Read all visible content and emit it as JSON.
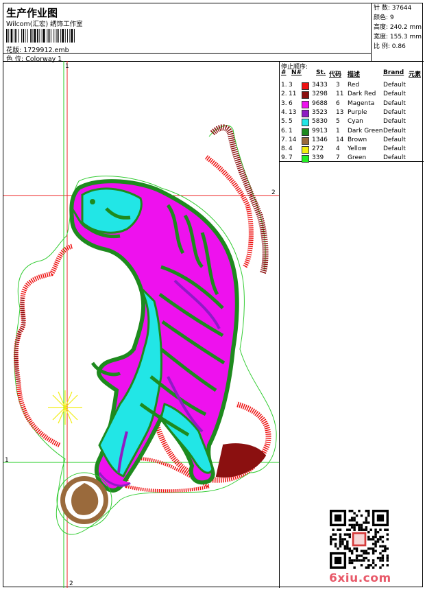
{
  "header": {
    "title": "生产作业图",
    "subtitle": "Wilcom(汇宏) 绣饰工作室"
  },
  "design": {
    "file_label": "花版: 1729912.emb",
    "colorway_label": "色 位:  Colorway 1"
  },
  "stats": [
    "针 数: 37644",
    "颜色: 9",
    "高度: 240.2 mm",
    "宽度: 155.3 mm",
    "比 例: 0.86"
  ],
  "sequence": {
    "title": "停止顺序:",
    "headers": {
      "num": "#",
      "n": "N#",
      "st": "St.",
      "code": "代码",
      "desc": "描述",
      "brand": "Brand",
      "element": "元素"
    },
    "rows": [
      {
        "idx": "1.",
        "n": "3",
        "color": "#ee1111",
        "st": "3433",
        "code": "3",
        "desc": "Red",
        "brand": "Default"
      },
      {
        "idx": "2.",
        "n": "11",
        "color": "#8b1010",
        "st": "3298",
        "code": "11",
        "desc": "Dark Red",
        "brand": "Default"
      },
      {
        "idx": "3.",
        "n": "6",
        "color": "#ee11ee",
        "st": "9688",
        "code": "6",
        "desc": "Magenta",
        "brand": "Default"
      },
      {
        "idx": "4.",
        "n": "13",
        "color": "#8e1cc4",
        "st": "3523",
        "code": "13",
        "desc": "Purple",
        "brand": "Default"
      },
      {
        "idx": "5.",
        "n": "5",
        "color": "#22e6e6",
        "st": "5830",
        "code": "5",
        "desc": "Cyan",
        "brand": "Default"
      },
      {
        "idx": "6.",
        "n": "1",
        "color": "#1e8a1e",
        "st": "9913",
        "code": "1",
        "desc": "Dark Green",
        "brand": "Default"
      },
      {
        "idx": "7.",
        "n": "14",
        "color": "#9a6a3c",
        "st": "1346",
        "code": "14",
        "desc": "Brown",
        "brand": "Default"
      },
      {
        "idx": "8.",
        "n": "4",
        "color": "#f2ee10",
        "st": "272",
        "code": "4",
        "desc": "Yellow",
        "brand": "Default"
      },
      {
        "idx": "9.",
        "n": "7",
        "color": "#22ee22",
        "st": "339",
        "code": "7",
        "desc": "Green",
        "brand": "Default"
      }
    ]
  },
  "guides": {
    "h_top_label": "2",
    "h_bottom_label": "1",
    "v_left_label": "1",
    "v_bottom_label": "2"
  },
  "watermark": "6xiu.com"
}
